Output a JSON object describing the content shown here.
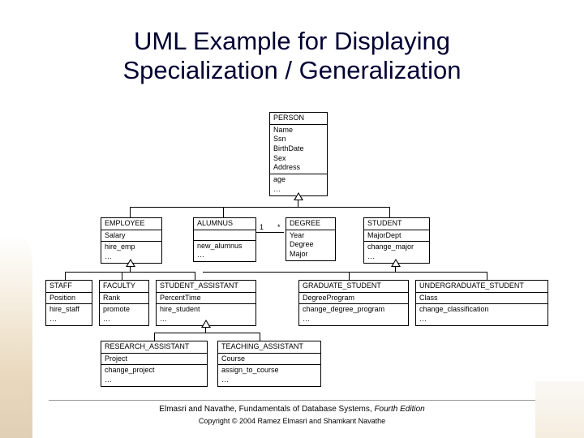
{
  "title_l1": "UML Example for Displaying",
  "title_l2": "Specialization / Generalization",
  "person": {
    "name": "PERSON",
    "attrs": "Name\nSsn\nBirthDate\nSex\nAddress",
    "ops": "age\n…"
  },
  "row2": {
    "employee": {
      "name": "EMPLOYEE",
      "attrs": "Salary",
      "ops": "hire_emp\n…"
    },
    "alumnus": {
      "name": "ALUMNUS",
      "attrs": "",
      "ops": "new_alumnus\n…"
    },
    "degree": {
      "name": "DEGREE",
      "attrs": "Year\nDegree\nMajor",
      "ops": ""
    },
    "student": {
      "name": "STUDENT",
      "attrs": "MajorDept",
      "ops": "change_major\n…"
    }
  },
  "row3": {
    "staff": {
      "name": "STAFF",
      "attrs": "Position",
      "ops": "hire_staff\n…"
    },
    "faculty": {
      "name": "FACULTY",
      "attrs": "Rank",
      "ops": "promote\n…"
    },
    "student_assistant": {
      "name": "STUDENT_ASSISTANT",
      "attrs": "PercentTime",
      "ops": "hire_student\n…"
    },
    "graduate_student": {
      "name": "GRADUATE_STUDENT",
      "attrs": "DegreeProgram",
      "ops": "change_degree_program\n…"
    },
    "undergraduate_student": {
      "name": "UNDERGRADUATE_STUDENT",
      "attrs": "Class",
      "ops": "change_classification\n…"
    }
  },
  "row4": {
    "research_assistant": {
      "name": "RESEARCH_ASSISTANT",
      "attrs": "Project",
      "ops": "change_project\n…"
    },
    "teaching_assistant": {
      "name": "TEACHING_ASSISTANT",
      "attrs": "Course",
      "ops": "assign_to_course\n…"
    }
  },
  "mult": {
    "left": "1",
    "right": "*"
  },
  "credit_pre": "Elmasri and Navathe, Fundamentals of Database Systems, ",
  "credit_em": "Fourth Edition",
  "copyright": "Copyright © 2004 Ramez Elmasri and Shamkant Navathe"
}
